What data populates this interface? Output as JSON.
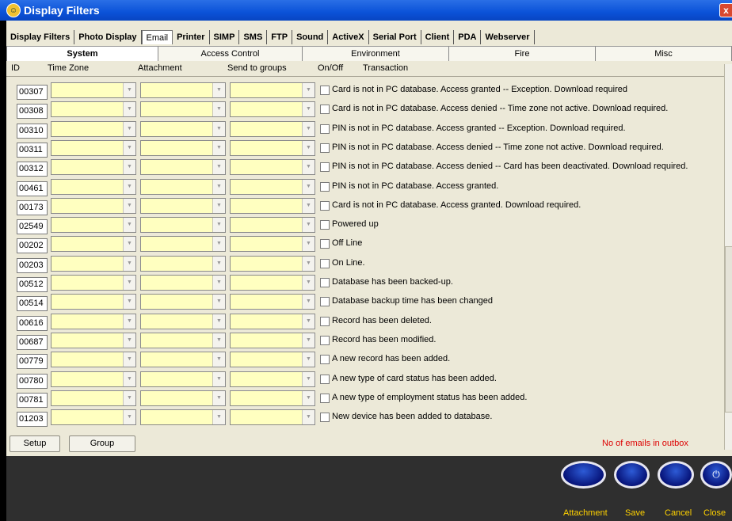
{
  "window": {
    "title": "Display Filters",
    "logo_glyph": "☺",
    "close_glyph": "x"
  },
  "top_tabs": [
    "Display Filters",
    "Photo Display",
    "Email",
    "Printer",
    "SIMP",
    "SMS",
    "FTP",
    "Sound",
    "ActiveX",
    "Serial Port",
    "Client",
    "PDA",
    "Webserver"
  ],
  "sub_tabs": [
    "System",
    "Access Control",
    "Environment",
    "Fire",
    "Misc"
  ],
  "columns": {
    "id": "ID",
    "time_zone": "Time Zone",
    "attachment": "Attachment",
    "send_to_groups": "Send to groups",
    "on_off": "On/Off",
    "transaction": "Transaction"
  },
  "rows": [
    {
      "id": "00307",
      "text": "Card is not in PC database. Access granted -- Exception. Download required"
    },
    {
      "id": "00308",
      "text": "Card is not in PC database. Access denied -- Time zone not active. Download required."
    },
    {
      "id": "00310",
      "text": "PIN is not in PC database. Access granted -- Exception. Download required."
    },
    {
      "id": "00311",
      "text": "PIN is not in PC database. Access denied -- Time zone not active. Download required."
    },
    {
      "id": "00312",
      "text": "PIN is not in PC database. Access denied -- Card has been deactivated. Download required."
    },
    {
      "id": "00461",
      "text": "PIN is not in PC database. Access granted."
    },
    {
      "id": "00173",
      "text": "Card is not in PC database. Access granted. Download required."
    },
    {
      "id": "02549",
      "text": "Powered up"
    },
    {
      "id": "00202",
      "text": "Off Line"
    },
    {
      "id": "00203",
      "text": "On Line."
    },
    {
      "id": "00512",
      "text": "Database has been backed-up."
    },
    {
      "id": "00514",
      "text": "Database backup time has been changed"
    },
    {
      "id": "00616",
      "text": "Record has been deleted."
    },
    {
      "id": "00687",
      "text": "Record has been modified."
    },
    {
      "id": "00779",
      "text": "A new record has been added."
    },
    {
      "id": "00780",
      "text": "A new type of card status has been added."
    },
    {
      "id": "00781",
      "text": "A new type of employment status has been added."
    },
    {
      "id": "01203",
      "text": "New device has been added to database."
    }
  ],
  "buttons": {
    "setup": "Setup",
    "group": "Group"
  },
  "outbox_label": "No of emails in outbox",
  "footer": {
    "attachment": "Attachment",
    "save": "Save",
    "cancel": "Cancel",
    "close": "Close",
    "power_glyph": "⏻"
  },
  "colors": {
    "title_blue": "#0b52d8",
    "combo_yellow": "#ffffc0",
    "footer_dark": "#2f2f2f",
    "footer_label": "#ffd200",
    "outbox_red": "#dd0000"
  }
}
